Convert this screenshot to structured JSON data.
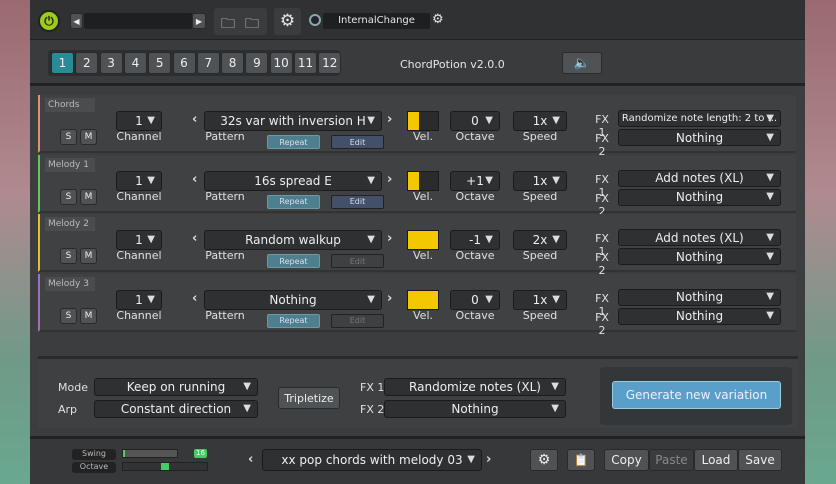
{
  "header": {
    "preset_name": "",
    "midi_label": "InternalChange",
    "power_color": "#9ccc1c"
  },
  "tabs": [
    "1",
    "2",
    "3",
    "4",
    "5",
    "6",
    "7",
    "8",
    "9",
    "10",
    "11",
    "12"
  ],
  "active_tab": 0,
  "app_title": "ChordPotion v2.0.0",
  "labels": {
    "channel": "Channel",
    "pattern": "Pattern",
    "vel": "Vel.",
    "octave": "Octave",
    "speed": "Speed",
    "fx1": "FX 1",
    "fx2": "FX 2",
    "solo": "S",
    "mute": "M",
    "repeat": "Repeat",
    "edit": "Edit"
  },
  "rows": [
    {
      "name": "Chords",
      "color": "#e0907a",
      "channel": "1",
      "pattern": "32s var with inversion H",
      "velocity": 0.35,
      "octave": "0",
      "speed": "1x",
      "fx1": "Randomize note length: 2 to ...",
      "fx2": "Nothing",
      "edit_enabled": true
    },
    {
      "name": "Melody 1",
      "color": "#6cc060",
      "channel": "1",
      "pattern": "16s spread E",
      "velocity": 0.35,
      "octave": "+1",
      "speed": "1x",
      "fx1": "Add notes (XL)",
      "fx2": "Nothing",
      "edit_enabled": true
    },
    {
      "name": "Melody 2",
      "color": "#e0c030",
      "channel": "1",
      "pattern": "Random walkup",
      "velocity": 1,
      "octave": "-1",
      "speed": "2x",
      "fx1": "Add notes (XL)",
      "fx2": "Nothing",
      "edit_enabled": false
    },
    {
      "name": "Melody 3",
      "color": "#a070c0",
      "channel": "1",
      "pattern": "Nothing",
      "velocity": 1,
      "octave": "0",
      "speed": "1x",
      "fx1": "Nothing",
      "fx2": "Nothing",
      "edit_enabled": false
    }
  ],
  "global": {
    "mode_label": "Mode",
    "mode": "Keep on running",
    "arp_label": "Arp",
    "arp": "Constant direction",
    "tripletize": "Tripletize",
    "fx1": "Randomize notes (XL)",
    "fx2": "Nothing",
    "generate": "Generate new variation"
  },
  "footer": {
    "swing_label": "Swing",
    "octave_label": "Octave",
    "swing_value": "16",
    "preset": "xx pop chords with melody 03",
    "copy": "Copy",
    "paste": "Paste",
    "load": "Load",
    "save": "Save"
  }
}
